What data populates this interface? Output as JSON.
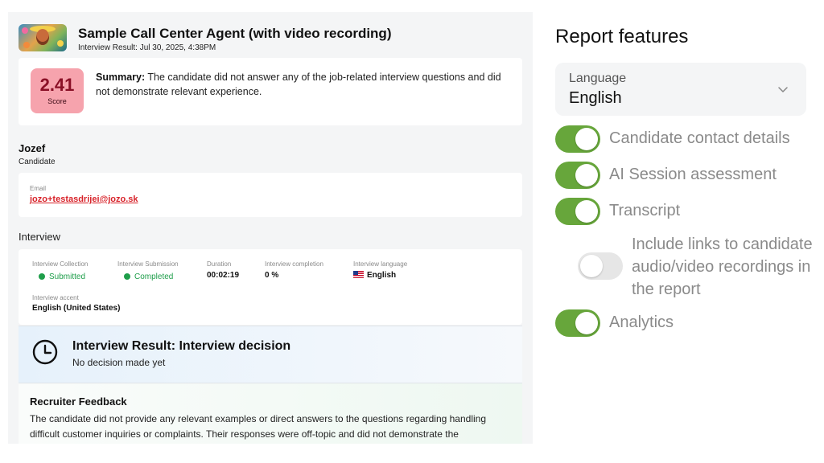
{
  "report": {
    "title": "Sample Call Center Agent (with video recording)",
    "subtitle": "Interview Result: Jul 30, 2025, 4:38PM",
    "summary": {
      "score_value": "2.41",
      "score_label": "Score",
      "label": "Summary:",
      "text": " The candidate did not answer any of the job-related interview questions and did not demonstrate relevant experience."
    },
    "candidate": {
      "name": "Jozef",
      "role": "Candidate",
      "email_label": "Email",
      "email": "jozo+testasdrijei@jozo.sk"
    },
    "interview": {
      "section_title": "Interview",
      "collection_label": "Interview Collection",
      "collection_value": "Submitted",
      "submission_label": "Interview Submission",
      "submission_value": "Completed",
      "duration_label": "Duration",
      "duration_value": "00:02:19",
      "completion_label": "Interview completion",
      "completion_value": "0 %",
      "language_label": "Interview language",
      "language_value": "English",
      "accent_label": "Interview accent",
      "accent_value": "English (United States)"
    },
    "result": {
      "title": "Interview Result: Interview decision",
      "subtitle": "No decision made yet"
    },
    "feedback": {
      "title": "Recruiter Feedback",
      "text": "The candidate did not provide any relevant examples or direct answers to the questions regarding handling difficult customer inquiries or complaints. Their responses were off-topic and did not demonstrate the"
    }
  },
  "features": {
    "title": "Report features",
    "language_label": "Language",
    "language_value": "English",
    "toggles": [
      {
        "label": "Candidate contact details",
        "on": true
      },
      {
        "label": "AI Session assessment",
        "on": true
      },
      {
        "label": "Transcript",
        "on": true
      },
      {
        "label": "Include links to candidate audio/video recordings in the report",
        "on": false
      },
      {
        "label": "Analytics",
        "on": true
      }
    ]
  },
  "colors": {
    "toggle_on": "#67a63b",
    "score_bg": "#f6a3ad",
    "status_green": "#1e9e4a",
    "email_red": "#d8232a"
  }
}
